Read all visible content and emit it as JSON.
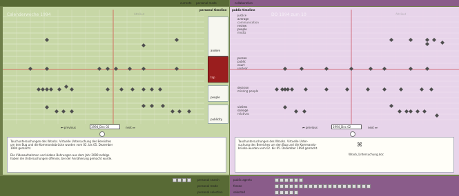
{
  "top": {
    "left_title_blur": "Calenderwoche 1994",
    "left_subtitle_blur": "Attribut",
    "center_label_1": "currents",
    "center_label_2": "personal mode",
    "center_right_label": "collaboration",
    "right_title_blur": "DO 1994 zum 10",
    "right_subtitle_blur": "Attribut"
  },
  "left": {
    "header_label": "personal timeline",
    "tabs": [
      {
        "label": "andere",
        "selected": false
      },
      {
        "label": "top",
        "selected": true
      },
      {
        "label": "people",
        "selected": false
      },
      {
        "label": "publicity",
        "selected": false
      }
    ],
    "nav": {
      "prev": "previous",
      "date": "1994_Dec 02",
      "next": "next"
    },
    "text_lines": [
      "Tauchuntersuchungen des Wracks. Virtuelle Untersuchung des Bereiches",
      "um den Bug und die Kommandobrücke wurden vom 02. bis 05. Dezember",
      "1994 gemacht.",
      "",
      "Die Videoaufnahmen und sieben Bohrungen aus dem Jahr 2000 zufolge",
      "haben die Untersuchungen offensiv, bei der Annäherung gemacht wurde."
    ]
  },
  "right": {
    "header_label": "public timeline",
    "categories_top": [
      "justice",
      "average",
      "communication",
      "review",
      "people",
      "media"
    ],
    "categories_mid": [
      "person",
      "public",
      "court",
      "unclear"
    ],
    "categories_low": [
      "decision",
      "missing people"
    ],
    "categories_bottom": [
      "victims",
      "salvage",
      "relatives"
    ],
    "nav": {
      "prev": "previous",
      "date": "1994_Dec 02",
      "next": "next"
    },
    "text_lines": [
      "Tauchuntersuchungen des Wracks. Virtuelle Unter-",
      "suchung des Bereiches um den Bug und die Kommando-",
      "brücke wurden vom 02. bis 05. Dezember 1994 gemacht."
    ],
    "attachment_label": "Wrack_Untersuchung.doc"
  },
  "bottom": {
    "row1_left": "personal search",
    "row1_right": "public agents",
    "row2_left": "personal mode",
    "row2_right": "freeze",
    "row3_left": "personal selection",
    "row3_right": "selected"
  },
  "colors": {
    "selected_tab": "#9a1e1e",
    "left_bg": "#c7d7a6",
    "right_bg": "#e7d4ea",
    "marker": "#4f4f4f"
  }
}
